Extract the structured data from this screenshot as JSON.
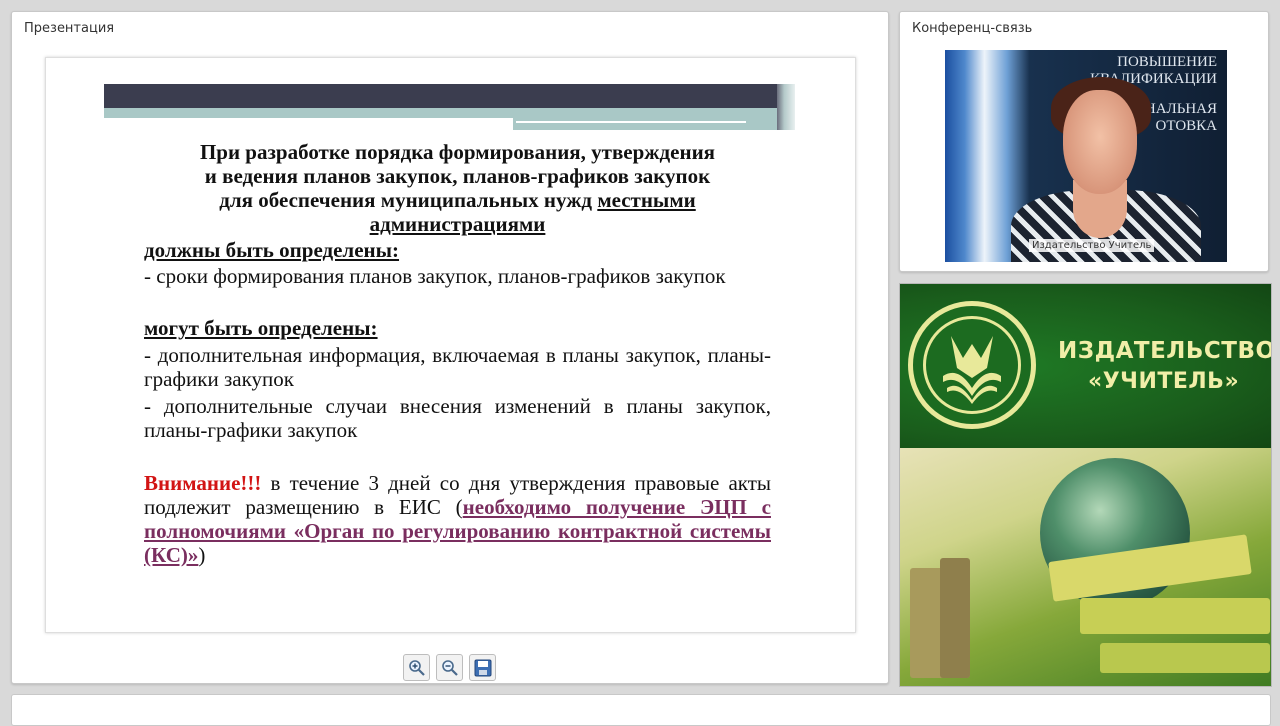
{
  "presentation": {
    "title": "Презентация",
    "slide": {
      "heading_line1": "При разработке порядка формирования, утверждения",
      "heading_line2": "и ведения планов закупок, планов-графиков закупок",
      "heading_line3": "для обеспечения муниципальных нужд",
      "heading_underlined": "местными администрациями",
      "must_label": "должны быть определены:",
      "must_item1": "- сроки формирования планов закупок, планов-графиков закупок",
      "may_label": "могут быть определены:",
      "may_item1": "- дополнительная информация, включаемая в планы закупок, планы-графики закупок",
      "may_item2": "- дополнительные случаи внесения изменений в планы закупок, планы-графики закупок",
      "attention_label": "Внимание!!!",
      "attention_text": " в течение 3 дней со дня утверждения правовые акты подлежит размещению в ЕИС (",
      "attention_link": "необходимо получение ЭЦП с полномочиями «Орган по регулированию контрактной системы (КС)»",
      "attention_close": ")"
    },
    "toolbar": {
      "zoom_in_icon": "zoom-in-icon",
      "zoom_out_icon": "zoom-out-icon",
      "save_icon": "save-icon"
    }
  },
  "conference": {
    "title": "Конференц-связь",
    "video_label": "Издательство Учитель",
    "background_text": {
      "line1": "ПОВЫШЕНИЕ",
      "line2": "КВАЛИФИКАЦИИ",
      "line3": "НАЛЬНАЯ",
      "line4": "ОТОВКА"
    }
  },
  "ad": {
    "title_line1": "ИЗДАТЕЛЬСТВО",
    "title_line2": "«УЧИТЕЛЬ»"
  }
}
